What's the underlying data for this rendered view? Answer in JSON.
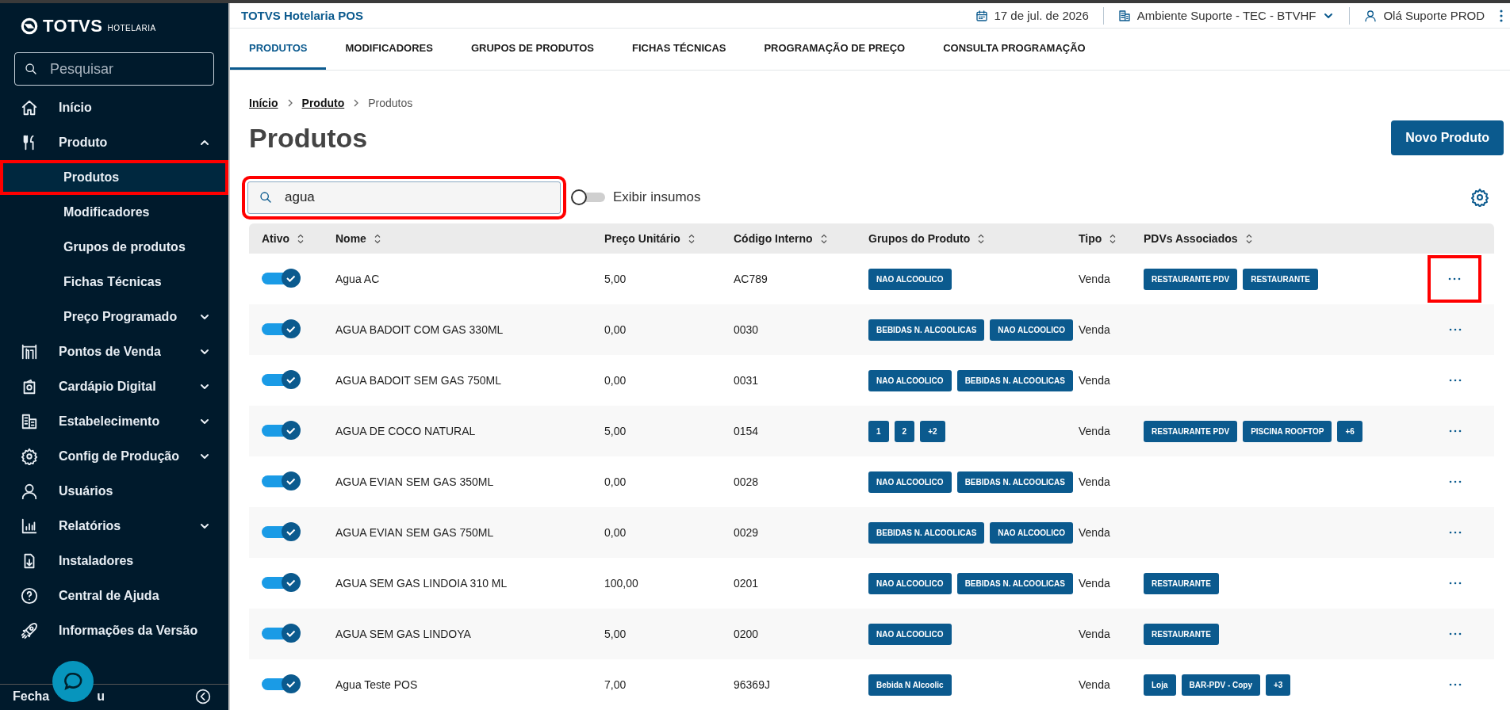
{
  "sidebar": {
    "logo": {
      "brand": "TOTVS",
      "sub": "HOTELARIA"
    },
    "search": {
      "placeholder": "Pesquisar"
    },
    "items": [
      {
        "label": "Início"
      },
      {
        "label": "Produto",
        "expanded": true,
        "children": [
          {
            "label": "Produtos",
            "selected": true,
            "highlighted": true
          },
          {
            "label": "Modificadores",
            "selected": false,
            "highlighted": false
          },
          {
            "label": "Grupos de produtos",
            "selected": false,
            "highlighted": false
          },
          {
            "label": "Fichas Técnicas",
            "selected": false,
            "highlighted": false
          },
          {
            "label": "Preço Programado",
            "selected": false,
            "highlighted": false,
            "expanded": false
          }
        ]
      },
      {
        "label": "Pontos de Venda",
        "expanded": false
      },
      {
        "label": "Cardápio Digital",
        "expanded": false
      },
      {
        "label": "Estabelecimento",
        "expanded": false
      },
      {
        "label": "Config de Produção",
        "expanded": false
      },
      {
        "label": "Usuários"
      },
      {
        "label": "Relatórios",
        "expanded": false
      },
      {
        "label": "Instaladores"
      },
      {
        "label": "Central de Ajuda"
      },
      {
        "label": "Informações da Versão"
      }
    ],
    "footer": {
      "label_start": "Fecha",
      "label_end": "u"
    }
  },
  "header": {
    "app_title": "TOTVS Hotelaria POS",
    "date": "17 de jul. de 2026",
    "environment": "Ambiente Suporte - TEC - BTVHF",
    "user": "Olá Suporte PROD"
  },
  "tabs": [
    {
      "label": "PRODUTOS",
      "selected": true
    },
    {
      "label": "MODIFICADORES",
      "selected": false
    },
    {
      "label": "GRUPOS DE PRODUTOS",
      "selected": false
    },
    {
      "label": "FICHAS TÉCNICAS",
      "selected": false
    },
    {
      "label": "PROGRAMAÇÃO DE PREÇO",
      "selected": false
    },
    {
      "label": "CONSULTA PROGRAMAÇÃO",
      "selected": false
    }
  ],
  "breadcrumb": [
    {
      "label": "Início",
      "link": true
    },
    {
      "label": "Produto",
      "link": true
    },
    {
      "label": "Produtos",
      "link": false
    }
  ],
  "page_title": "Produtos",
  "new_button": "Novo Produto",
  "search": {
    "value": "agua",
    "highlighted": true
  },
  "show_inputs": {
    "label": "Exibir insumos",
    "on": false
  },
  "table": {
    "columns": [
      "Ativo",
      "Nome",
      "Preço Unitário",
      "Código Interno",
      "Grupos do Produto",
      "Tipo",
      "PDVs Associados"
    ],
    "rows": [
      {
        "active": true,
        "name": "Agua AC",
        "price": "5,00",
        "code": "AC789",
        "groups": [
          "NAO ALCOOLICO"
        ],
        "type": "Venda",
        "pdvs": [
          "RESTAURANTE PDV",
          "RESTAURANTE"
        ],
        "actions_highlighted": true
      },
      {
        "active": true,
        "name": "AGUA BADOIT COM GAS 330ML",
        "price": "0,00",
        "code": "0030",
        "groups": [
          "BEBIDAS N. ALCOOLICAS",
          "NAO ALCOOLICO"
        ],
        "type": "Venda",
        "pdvs": [],
        "actions_highlighted": false
      },
      {
        "active": true,
        "name": "AGUA BADOIT SEM GAS 750ML",
        "price": "0,00",
        "code": "0031",
        "groups": [
          "NAO ALCOOLICO",
          "BEBIDAS N. ALCOOLICAS"
        ],
        "type": "Venda",
        "pdvs": [],
        "actions_highlighted": false
      },
      {
        "active": true,
        "name": "AGUA DE COCO NATURAL",
        "price": "5,00",
        "code": "0154",
        "groups": [
          "1",
          "2",
          "+2"
        ],
        "type": "Venda",
        "pdvs": [
          "RESTAURANTE PDV",
          "PISCINA ROOFTOP",
          "+6"
        ],
        "actions_highlighted": false
      },
      {
        "active": true,
        "name": "AGUA EVIAN SEM GAS 350ML",
        "price": "0,00",
        "code": "0028",
        "groups": [
          "NAO ALCOOLICO",
          "BEBIDAS N. ALCOOLICAS"
        ],
        "type": "Venda",
        "pdvs": [],
        "actions_highlighted": false
      },
      {
        "active": true,
        "name": "AGUA EVIAN SEM GAS 750ML",
        "price": "0,00",
        "code": "0029",
        "groups": [
          "BEBIDAS N. ALCOOLICAS",
          "NAO ALCOOLICO"
        ],
        "type": "Venda",
        "pdvs": [],
        "actions_highlighted": false
      },
      {
        "active": true,
        "name": "AGUA SEM GAS LINDOIA 310 ML",
        "price": "100,00",
        "code": "0201",
        "groups": [
          "NAO ALCOOLICO",
          "BEBIDAS N. ALCOOLICAS"
        ],
        "type": "Venda",
        "pdvs": [
          "RESTAURANTE"
        ],
        "actions_highlighted": false
      },
      {
        "active": true,
        "name": "AGUA SEM GAS LINDOYA",
        "price": "5,00",
        "code": "0200",
        "groups": [
          "NAO ALCOOLICO"
        ],
        "type": "Venda",
        "pdvs": [
          "RESTAURANTE"
        ],
        "actions_highlighted": false
      },
      {
        "active": true,
        "name": "Agua Teste POS",
        "price": "7,00",
        "code": "96369J",
        "groups": [
          "Bebida N Alcoolic"
        ],
        "type": "Venda",
        "pdvs": [
          "Loja",
          "BAR-PDV - Copy",
          "+3"
        ],
        "actions_highlighted": false
      }
    ]
  }
}
